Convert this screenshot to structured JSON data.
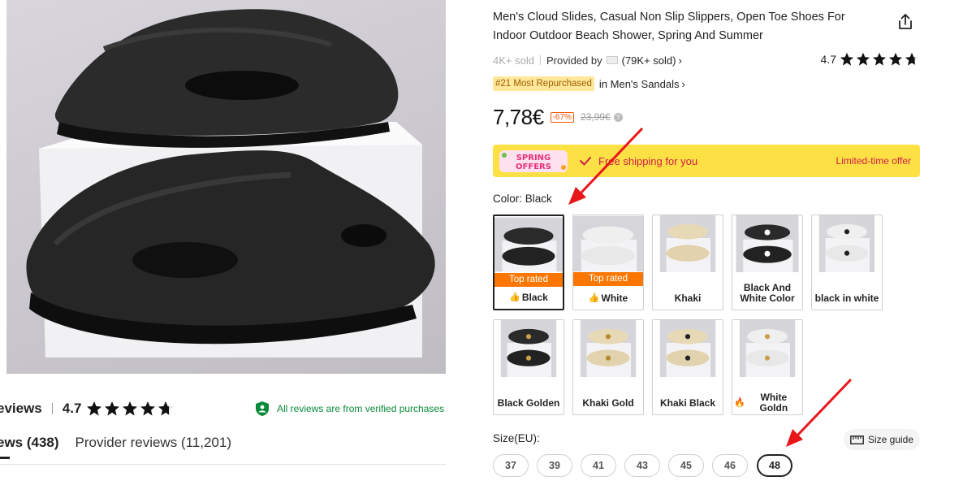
{
  "product": {
    "title": "Men's Cloud Slides, Casual Non Slip Slippers, Open Toe Shoes For Indoor Outdoor Beach Shower, Spring And Summer",
    "sold": "4K+ sold",
    "provided_by_label": "Provided by",
    "provider_sold": "(79K+ sold)",
    "rating": "4.7",
    "rank_badge": "#21 Most Repurchased",
    "rank_category": "in Men's Sandals",
    "price": "7,78€",
    "discount": "-67%",
    "old_price": "23,99€"
  },
  "promo": {
    "badge_line1": "SPRING",
    "badge_line2": "OFFERS",
    "text": "Free shipping for you",
    "limited": "Limited-time offer"
  },
  "color": {
    "label": "Color: Black",
    "options": [
      {
        "name": "Black",
        "badge": "Top rated",
        "tone": "black"
      },
      {
        "name": "White",
        "badge": "Top rated",
        "tone": "white"
      },
      {
        "name": "Khaki",
        "badge": "",
        "tone": "khaki"
      },
      {
        "name": "Black And White Color",
        "badge": "",
        "tone": "bw"
      },
      {
        "name": "black in white",
        "badge": "",
        "tone": "white"
      },
      {
        "name": "Black Golden",
        "badge": "",
        "tone": "black"
      },
      {
        "name": "Khaki Gold",
        "badge": "",
        "tone": "khaki"
      },
      {
        "name": "Khaki Black",
        "badge": "",
        "tone": "khaki"
      },
      {
        "name": "White Goldn",
        "badge": "",
        "tone": "white"
      }
    ],
    "selected": "Black"
  },
  "size": {
    "label": "Size(EU):",
    "guide": "Size guide",
    "options": [
      "37",
      "39",
      "41",
      "43",
      "45",
      "46",
      "48"
    ],
    "selected": "48"
  },
  "reviews": {
    "title": "eviews",
    "rating": "4.7",
    "verified": "All reviews are from verified purchases",
    "tab_active": "ews (438)",
    "tab_provider": "Provider reviews (11,201)"
  },
  "colors": {
    "accent": "#fb7701",
    "promo_bg": "#fde044",
    "promo_text": "#d01d4a",
    "verified_green": "#0a8a3a",
    "arrow_red": "#e8161b"
  }
}
